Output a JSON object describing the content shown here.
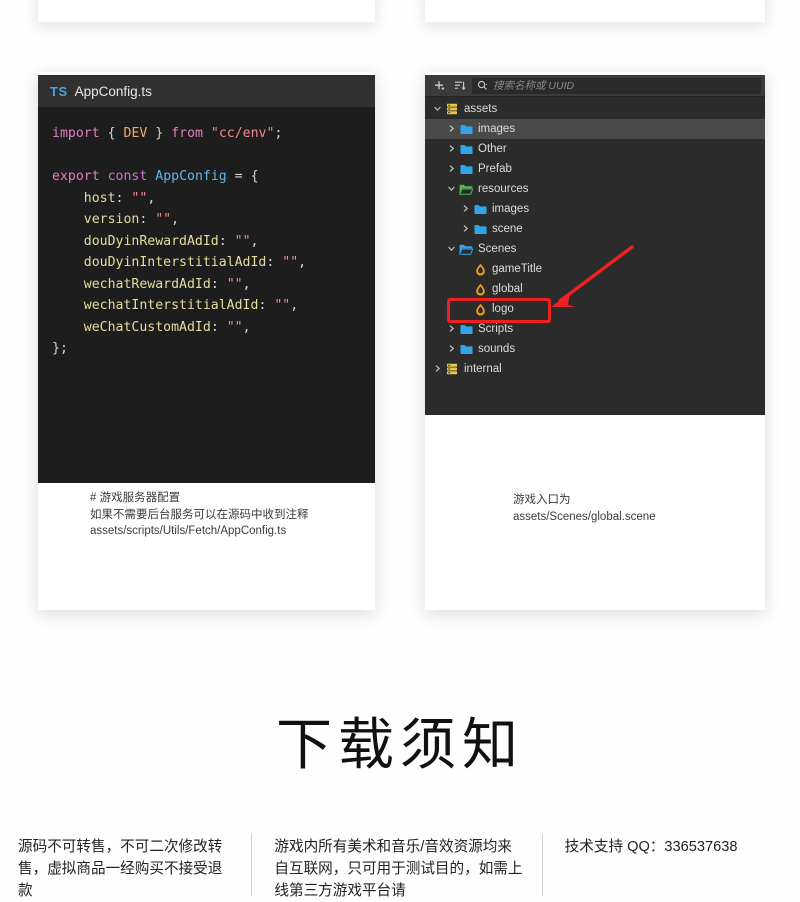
{
  "page": {
    "background": "#ffffff",
    "heading": "下载须知"
  },
  "top_cards": [
    {
      "name": "top-card-left"
    },
    {
      "name": "top-card-right"
    }
  ],
  "editor": {
    "tab": {
      "badge": "TS",
      "filename": "AppConfig.ts"
    },
    "theme": {
      "tabbar_bg": "#303030",
      "editor_bg": "#1d1d1d",
      "keyword": "#e57ec4",
      "identifier": "#f0a878",
      "class": "#63b8e8",
      "string": "#f18a8a",
      "property": "#e8dba0"
    },
    "code_lines": [
      {
        "tokens": [
          {
            "t": "import",
            "c": "kw"
          },
          {
            "t": " ",
            "c": "op"
          },
          {
            "t": "{",
            "c": "punc"
          },
          {
            "t": " ",
            "c": "op"
          },
          {
            "t": "DEV",
            "c": "ident"
          },
          {
            "t": " ",
            "c": "op"
          },
          {
            "t": "}",
            "c": "punc"
          },
          {
            "t": " ",
            "c": "op"
          },
          {
            "t": "from",
            "c": "kw"
          },
          {
            "t": " ",
            "c": "op"
          },
          {
            "t": "\"cc/env\"",
            "c": "str"
          },
          {
            "t": ";",
            "c": "punc"
          }
        ]
      },
      {
        "tokens": []
      },
      {
        "tokens": [
          {
            "t": "export",
            "c": "kw"
          },
          {
            "t": " ",
            "c": "op"
          },
          {
            "t": "const",
            "c": "kw2"
          },
          {
            "t": " ",
            "c": "op"
          },
          {
            "t": "AppConfig",
            "c": "cls"
          },
          {
            "t": " ",
            "c": "op"
          },
          {
            "t": "=",
            "c": "op"
          },
          {
            "t": " ",
            "c": "op"
          },
          {
            "t": "{",
            "c": "punc"
          }
        ]
      },
      {
        "tokens": [
          {
            "t": "    ",
            "c": "op"
          },
          {
            "t": "host",
            "c": "prop"
          },
          {
            "t": ": ",
            "c": "punc"
          },
          {
            "t": "\"\"",
            "c": "str"
          },
          {
            "t": ",",
            "c": "punc"
          }
        ]
      },
      {
        "tokens": [
          {
            "t": "    ",
            "c": "op"
          },
          {
            "t": "version",
            "c": "prop"
          },
          {
            "t": ": ",
            "c": "punc"
          },
          {
            "t": "\"\"",
            "c": "str"
          },
          {
            "t": ",",
            "c": "punc"
          }
        ]
      },
      {
        "tokens": [
          {
            "t": "    ",
            "c": "op"
          },
          {
            "t": "douDyinRewardAdId",
            "c": "prop"
          },
          {
            "t": ": ",
            "c": "punc"
          },
          {
            "t": "\"\"",
            "c": "str"
          },
          {
            "t": ",",
            "c": "punc"
          }
        ]
      },
      {
        "tokens": [
          {
            "t": "    ",
            "c": "op"
          },
          {
            "t": "douDyinInterstitialAdId",
            "c": "prop"
          },
          {
            "t": ": ",
            "c": "punc"
          },
          {
            "t": "\"\"",
            "c": "str"
          },
          {
            "t": ",",
            "c": "punc"
          }
        ]
      },
      {
        "tokens": [
          {
            "t": "    ",
            "c": "op"
          },
          {
            "t": "wechatRewardAdId",
            "c": "prop"
          },
          {
            "t": ": ",
            "c": "punc"
          },
          {
            "t": "\"\"",
            "c": "str"
          },
          {
            "t": ",",
            "c": "punc"
          }
        ]
      },
      {
        "tokens": [
          {
            "t": "    ",
            "c": "op"
          },
          {
            "t": "wechatInterstitialAdId",
            "c": "prop"
          },
          {
            "t": ": ",
            "c": "punc"
          },
          {
            "t": "\"\"",
            "c": "str"
          },
          {
            "t": ",",
            "c": "punc"
          }
        ]
      },
      {
        "tokens": [
          {
            "t": "    ",
            "c": "op"
          },
          {
            "t": "weChatCustomAdId",
            "c": "prop"
          },
          {
            "t": ": ",
            "c": "punc"
          },
          {
            "t": "\"\"",
            "c": "str"
          },
          {
            "t": ",",
            "c": "punc"
          }
        ]
      },
      {
        "tokens": [
          {
            "t": "};",
            "c": "punc"
          }
        ]
      }
    ],
    "caption_lines": [
      "# 游戏服务器配置",
      "如果不需要后台服务可以在源码中收到注释",
      "assets/scripts/Utils/Fetch/AppConfig.ts"
    ]
  },
  "assets_panel": {
    "toolbar": {
      "add_icon": "plus-icon",
      "sort_icon": "sort-icon",
      "search_icon": "search-icon",
      "search_placeholder": "搜索名称或 UUID"
    },
    "tree": [
      {
        "label": "assets",
        "depth": 0,
        "expanded": true,
        "icon": "database-icon",
        "selected": false
      },
      {
        "label": "images",
        "depth": 1,
        "expanded": false,
        "icon": "folder-icon",
        "selected": true
      },
      {
        "label": "Other",
        "depth": 1,
        "expanded": false,
        "icon": "folder-icon",
        "selected": false
      },
      {
        "label": "Prefab",
        "depth": 1,
        "expanded": false,
        "icon": "folder-icon",
        "selected": false
      },
      {
        "label": "resources",
        "depth": 1,
        "expanded": true,
        "icon": "folder-open-green-icon",
        "selected": false
      },
      {
        "label": "images",
        "depth": 2,
        "expanded": false,
        "icon": "folder-icon",
        "selected": false
      },
      {
        "label": "scene",
        "depth": 2,
        "expanded": false,
        "icon": "folder-icon",
        "selected": false
      },
      {
        "label": "Scenes",
        "depth": 1,
        "expanded": true,
        "icon": "folder-open-icon",
        "selected": false
      },
      {
        "label": "gameTitle",
        "depth": 2,
        "expanded": null,
        "icon": "scene-icon",
        "selected": false
      },
      {
        "label": "global",
        "depth": 2,
        "expanded": null,
        "icon": "scene-icon",
        "selected": false
      },
      {
        "label": "logo",
        "depth": 2,
        "expanded": null,
        "icon": "scene-icon",
        "selected": false
      },
      {
        "label": "Scripts",
        "depth": 1,
        "expanded": false,
        "icon": "folder-icon",
        "selected": false
      },
      {
        "label": "sounds",
        "depth": 1,
        "expanded": false,
        "icon": "folder-icon",
        "selected": false
      },
      {
        "label": "internal",
        "depth": 0,
        "expanded": false,
        "icon": "database-icon",
        "selected": false
      }
    ],
    "annotation": {
      "highlight_target": "global",
      "highlight_color": "#ef2020",
      "arrow_color": "#ef2020"
    },
    "caption_lines": [
      "游戏入口为",
      "assets/Scenes/global.scene"
    ]
  },
  "footer": {
    "columns": [
      "源码不可转售，不可二次修改转售，虚拟商品一经购买不接受退款",
      "游戏内所有美术和音乐/音效资源均来自互联网，只可用于测试目的，如需上线第三方游戏平台请",
      "技术支持 QQ：336537638"
    ]
  }
}
